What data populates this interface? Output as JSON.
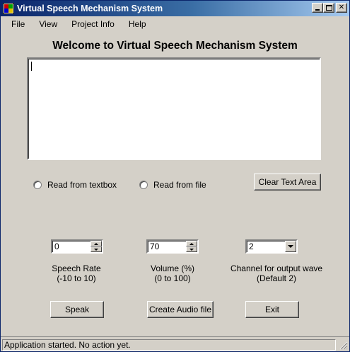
{
  "window": {
    "title": "Virtual Speech Mechanism System"
  },
  "menu": [
    "File",
    "View",
    "Project Info",
    "Help"
  ],
  "heading": "Welcome to Virtual Speech Mechanism System",
  "text_area": {
    "value": ""
  },
  "radios": {
    "read_textbox": "Read from textbox",
    "read_file": "Read from file"
  },
  "buttons": {
    "clear": "Clear Text Area",
    "speak": "Speak",
    "create_audio": "Create Audio file",
    "exit": "Exit"
  },
  "controls": {
    "speech_rate": {
      "value": "0",
      "label": "Speech Rate",
      "range": "(-10 to 10)"
    },
    "volume": {
      "value": "70",
      "label": "Volume (%)",
      "range": "(0 to 100)"
    },
    "channel": {
      "value": "2",
      "label": "Channel for output wave",
      "range": "(Default 2)"
    }
  },
  "status": "Application started. No action yet.",
  "icons": [
    "app-icon",
    "minimize-icon",
    "maximize-icon",
    "close-icon",
    "spin-up-icon",
    "spin-down-icon",
    "dropdown-arrow-icon",
    "size-grip-icon"
  ],
  "colors": {
    "window_bg": "#d4d0c8",
    "title_start": "#0a246a",
    "title_end": "#a6caf0"
  }
}
